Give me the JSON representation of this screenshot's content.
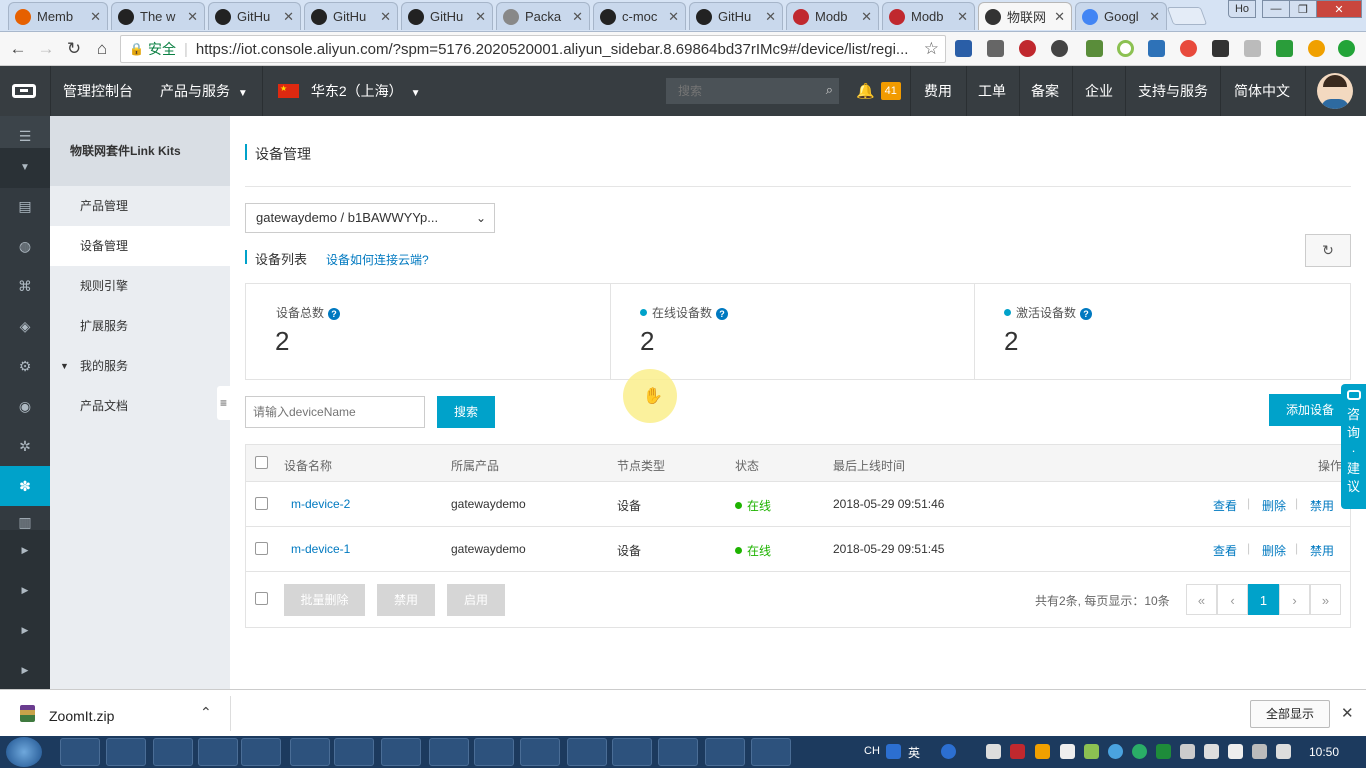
{
  "browser": {
    "tabs": [
      {
        "title": "Memb",
        "favicon": "firefox-icon",
        "color": "#e66000"
      },
      {
        "title": "The w",
        "favicon": "github-icon",
        "color": "#222222"
      },
      {
        "title": "GitHu",
        "favicon": "github-icon",
        "color": "#222222"
      },
      {
        "title": "GitHu",
        "favicon": "github-icon",
        "color": "#222222"
      },
      {
        "title": "GitHu",
        "favicon": "github-icon",
        "color": "#222222"
      },
      {
        "title": "Packa",
        "favicon": "document-icon",
        "color": "#888888"
      },
      {
        "title": "c-moc",
        "favicon": "github-icon",
        "color": "#222222"
      },
      {
        "title": "GitHu",
        "favicon": "github-icon",
        "color": "#222222"
      },
      {
        "title": "Modb",
        "favicon": "modbus-icon",
        "color": "#c0282e"
      },
      {
        "title": "Modb",
        "favicon": "modbus-icon",
        "color": "#c0282e"
      },
      {
        "title": "物联网",
        "favicon": "aliyun-icon",
        "color": "#333333",
        "active": true
      },
      {
        "title": "Googl",
        "favicon": "google-icon",
        "color": "#4285f4"
      }
    ],
    "profile_label": "Ho",
    "secure_label": "安全",
    "url": "https://iot.console.aliyun.com/?spm=5176.2020520001.aliyun_sidebar.8.69864bd37rIMc9#/device/list/regi..."
  },
  "console_header": {
    "console_label": "管理控制台",
    "products_label": "产品与服务",
    "region_label": "华东2（上海）",
    "search_placeholder": "搜索",
    "notification_count": "41",
    "nav_items": [
      "费用",
      "工单",
      "备案",
      "企业",
      "支持与服务",
      "简体中文"
    ]
  },
  "sidebar": {
    "title": "物联网套件Link Kits",
    "items": [
      {
        "label": "产品管理"
      },
      {
        "label": "设备管理",
        "selected": true
      },
      {
        "label": "规则引擎"
      },
      {
        "label": "扩展服务"
      },
      {
        "label": "我的服务",
        "expandable": true
      },
      {
        "label": "产品文档"
      }
    ]
  },
  "main": {
    "page_title": "设备管理",
    "product_select": "gatewaydemo / b1BAWWYYp...",
    "list_title": "设备列表",
    "connect_help_link": "设备如何连接云端?",
    "stats": [
      {
        "label": "设备总数",
        "value": "2",
        "dot": false
      },
      {
        "label": "在线设备数",
        "value": "2",
        "dot": true
      },
      {
        "label": "激活设备数",
        "value": "2",
        "dot": true
      }
    ],
    "search_placeholder": "请输入deviceName",
    "search_button": "搜索",
    "add_device_button": "添加设备",
    "table": {
      "headers": [
        "设备名称",
        "所属产品",
        "节点类型",
        "状态",
        "最后上线时间",
        "操作"
      ],
      "rows": [
        {
          "name": "m-device-2",
          "product": "gatewaydemo",
          "node_type": "设备",
          "status": "在线",
          "last_online": "2018-05-29 09:51:46",
          "actions": [
            "查看",
            "删除",
            "禁用"
          ]
        },
        {
          "name": "m-device-1",
          "product": "gatewaydemo",
          "node_type": "设备",
          "status": "在线",
          "last_online": "2018-05-29 09:51:45",
          "actions": [
            "查看",
            "删除",
            "禁用"
          ]
        }
      ]
    },
    "batch_delete_button": "批量删除",
    "disable_button": "禁用",
    "enable_button": "启用",
    "pagination_summary": "共有2条, 每页显示：10条",
    "current_page": "1",
    "pager": {
      "first": "«",
      "prev": "‹",
      "next": "›",
      "last": "»"
    }
  },
  "feedback_widget": {
    "chars": [
      "咨",
      "询",
      "·",
      "建",
      "议"
    ]
  },
  "download_bar": {
    "file_name": "ZoomIt.zip",
    "show_all_button": "全部显示"
  },
  "taskbar": {
    "ime_labels": [
      "CH",
      "英"
    ],
    "clock": "10:50"
  },
  "colors": {
    "console_header": "#373d41",
    "accent_blue": "#00a2ca",
    "link_blue": "#0079c0",
    "online_green": "#1eb300",
    "notification_badge": "#f29b00"
  }
}
